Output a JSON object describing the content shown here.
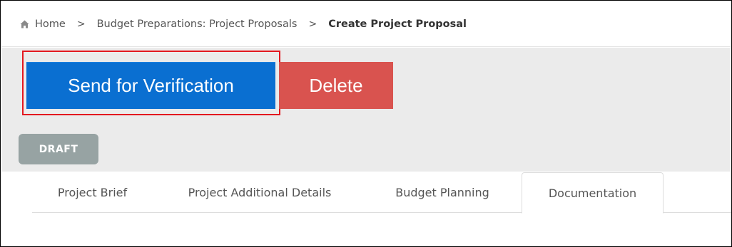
{
  "breadcrumb": {
    "home_icon": "home-icon",
    "home": "Home",
    "separator": ">",
    "parent": "Budget Preparations: Project Proposals",
    "current": "Create Project Proposal"
  },
  "actions": {
    "send_for_verification": "Send for Verification",
    "delete": "Delete"
  },
  "status_badge": "DRAFT",
  "tabs": [
    {
      "label": "Project Brief",
      "active": false
    },
    {
      "label": "Project Additional Details",
      "active": false
    },
    {
      "label": "Budget Planning",
      "active": false
    },
    {
      "label": "Documentation",
      "active": true
    }
  ],
  "colors": {
    "primary_button": "#0a6fd1",
    "danger_button": "#d9534f",
    "draft_badge": "#97a3a3",
    "highlight": "#e3181f",
    "content_background": "#ebebeb"
  }
}
